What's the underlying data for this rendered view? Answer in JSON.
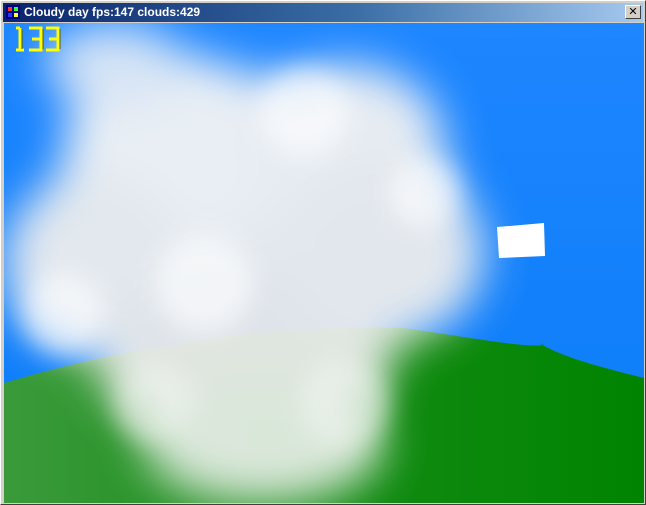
{
  "window": {
    "title": "Cloudy day fps:147 clouds:429",
    "close_label": "✕"
  },
  "hud": {
    "counter": "133",
    "counter_color": "#ffff00"
  },
  "scene": {
    "sky_color": "#0a7cf8",
    "ground_color": "#0a8a0a",
    "cloud_color": "#f2f2f2"
  }
}
